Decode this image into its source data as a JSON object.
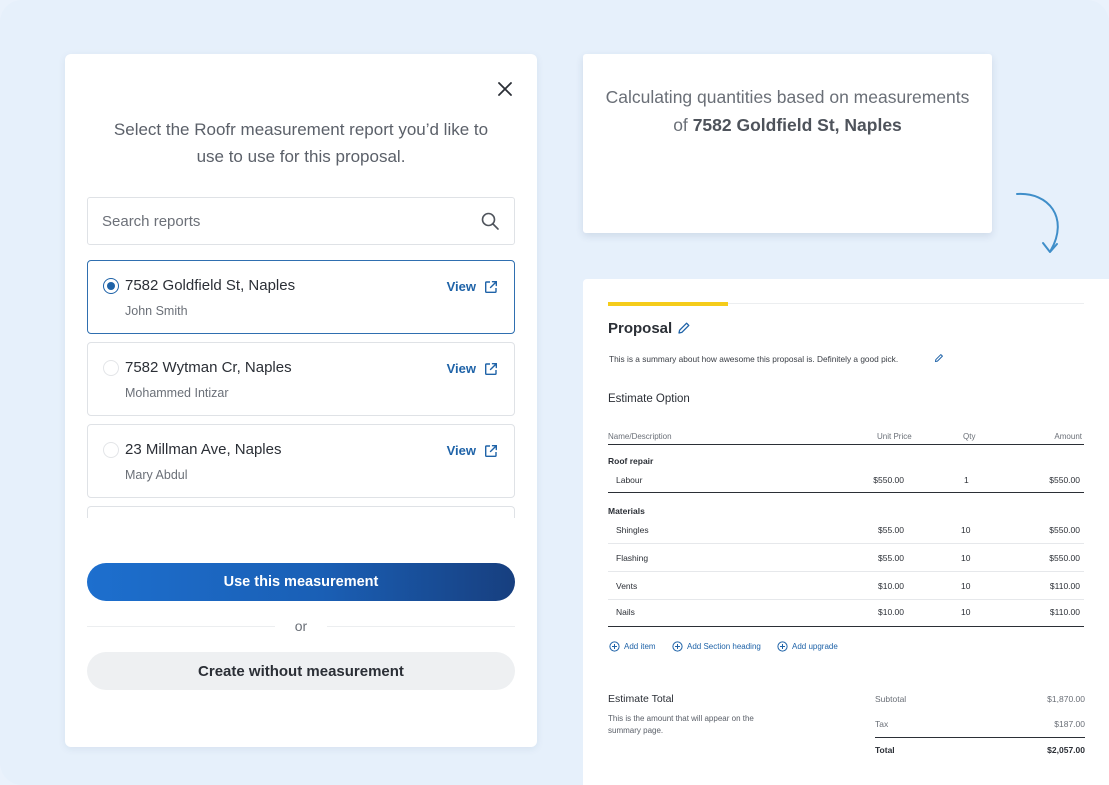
{
  "modal": {
    "title": "Select the Roofr measurement report you’d like to use to use for this proposal.",
    "search_placeholder": "Search reports",
    "reports": [
      {
        "address": "7582 Goldfield St, Naples",
        "owner": "John Smith",
        "view_label": "View",
        "selected": true
      },
      {
        "address": "7582 Wytman Cr, Naples",
        "owner": "Mohammed Intizar",
        "view_label": "View",
        "selected": false
      },
      {
        "address": "23 Millman Ave, Naples",
        "owner": "Mary Abdul",
        "view_label": "View",
        "selected": false
      }
    ],
    "primary_button": "Use this measurement",
    "or_label": "or",
    "secondary_button": "Create without measurement"
  },
  "calc": {
    "prefix": "Calculating quantities based on measurements",
    "of_label": "of",
    "address": "7582 Goldfield St, Naples"
  },
  "proposal": {
    "title": "Proposal",
    "summary": "This is a summary about how awesome this proposal is. Definitely a good pick.",
    "estimate_title": "Estimate Option",
    "columns": {
      "name": "Name/Description",
      "unit_price": "Unit Price",
      "qty": "Qty",
      "amount": "Amount"
    },
    "sections": [
      {
        "heading": "Roof repair",
        "rows": [
          {
            "name": "Labour",
            "unit_price": "$550.00",
            "qty": "1",
            "amount": "$550.00"
          }
        ]
      },
      {
        "heading": "Materials",
        "rows": [
          {
            "name": "Shingles",
            "unit_price": "$55.00",
            "qty": "10",
            "amount": "$550.00"
          },
          {
            "name": "Flashing",
            "unit_price": "$55.00",
            "qty": "10",
            "amount": "$550.00"
          },
          {
            "name": "Vents",
            "unit_price": "$10.00",
            "qty": "10",
            "amount": "$110.00"
          },
          {
            "name": "Nails",
            "unit_price": "$10.00",
            "qty": "10",
            "amount": "$110.00"
          }
        ]
      }
    ],
    "actions": {
      "add_item": "Add item",
      "add_section": "Add Section heading",
      "add_upgrade": "Add upgrade"
    },
    "total": {
      "title": "Estimate Total",
      "description": "This is the amount that will appear on the summary page.",
      "subtotal_label": "Subtotal",
      "subtotal": "$1,870.00",
      "tax_label": "Tax",
      "tax": "$187.00",
      "total_label": "Total",
      "total": "$2,057.00"
    }
  },
  "colors": {
    "accent": "#1f63a8",
    "highlight": "#f5cc1a",
    "background": "#e6f0fb"
  }
}
